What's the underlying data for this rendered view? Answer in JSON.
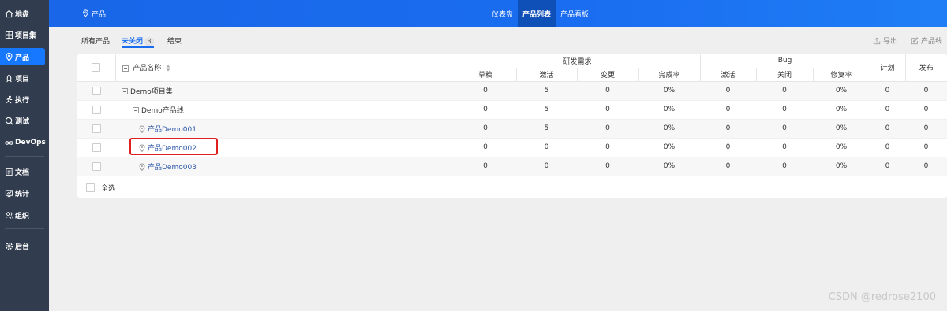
{
  "sidebar": {
    "items": [
      {
        "label": "地盘",
        "icon": "home-icon"
      },
      {
        "label": "项目集",
        "icon": "grid-icon"
      },
      {
        "label": "产品",
        "icon": "product-icon",
        "active": true
      },
      {
        "label": "项目",
        "icon": "project-icon"
      },
      {
        "label": "执行",
        "icon": "run-icon"
      },
      {
        "label": "测试",
        "icon": "test-icon"
      },
      {
        "label": "DevOps",
        "icon": "infinity-icon"
      },
      {
        "label": "文档",
        "icon": "doc-icon"
      },
      {
        "label": "统计",
        "icon": "chart-icon"
      },
      {
        "label": "组织",
        "icon": "org-icon"
      },
      {
        "label": "后台",
        "icon": "gear-icon"
      }
    ]
  },
  "header": {
    "module": "产品",
    "nav": [
      "仪表盘",
      "产品列表",
      "产品看板"
    ],
    "active_nav": "产品列表"
  },
  "toolbar": {
    "tabs": [
      {
        "label": "所有产品"
      },
      {
        "label": "未关闭",
        "count": "3",
        "active": true
      },
      {
        "label": "结束"
      }
    ],
    "export": "导出",
    "product_line": "产品线"
  },
  "table": {
    "col_name": "产品名称",
    "group_story": "研发需求",
    "group_bug": "Bug",
    "col_plan": "计划",
    "col_release": "发布",
    "story_cols": [
      "草稿",
      "激活",
      "变更",
      "完成率"
    ],
    "bug_cols": [
      "激活",
      "关闭",
      "修复率"
    ],
    "rows": [
      {
        "name": "Demo项目集",
        "level": 0,
        "type": "group",
        "values": [
          "0",
          "5",
          "0",
          "0%",
          "0",
          "0",
          "0%",
          "0",
          "0"
        ]
      },
      {
        "name": "Demo产品线",
        "level": 1,
        "type": "group",
        "values": [
          "0",
          "5",
          "0",
          "0%",
          "0",
          "0",
          "0%",
          "0",
          "0"
        ]
      },
      {
        "name": "产品Demo001",
        "level": 2,
        "type": "product",
        "values": [
          "0",
          "5",
          "0",
          "0%",
          "0",
          "0",
          "0%",
          "0",
          "0"
        ]
      },
      {
        "name": "产品Demo002",
        "level": 2,
        "type": "product",
        "values": [
          "0",
          "0",
          "0",
          "0%",
          "0",
          "0",
          "0%",
          "0",
          "0"
        ]
      },
      {
        "name": "产品Demo003",
        "level": 2,
        "type": "product",
        "values": [
          "0",
          "0",
          "0",
          "0%",
          "0",
          "0",
          "0%",
          "0",
          "0"
        ]
      }
    ],
    "select_all": "全选"
  },
  "watermark": "CSDN @redrose2100",
  "colors": {
    "accent": "#1a6df0",
    "sidebar": "#313c4e",
    "highlight": "#e02020"
  }
}
